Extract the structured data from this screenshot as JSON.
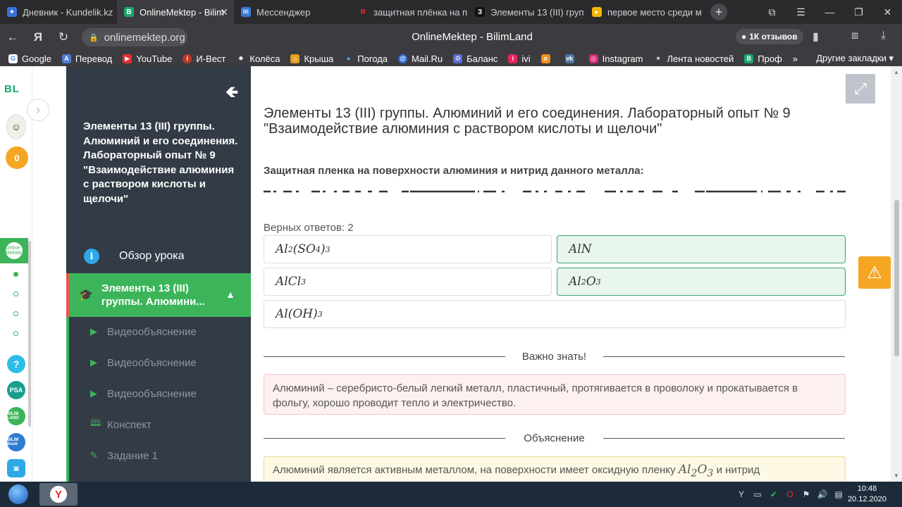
{
  "browser": {
    "tabs": [
      {
        "label": "Дневник - Kundelik.kz",
        "fav": "kundelik-icon",
        "color": "#3a6fd8"
      },
      {
        "label": "OnlineMektep - Bilim",
        "fav": "bilimland-icon",
        "color": "#1aa86b"
      },
      {
        "label": "Мессенджер",
        "fav": "messenger-icon",
        "color": "#3a7bd5"
      },
      {
        "label": "защитная плёнка на п",
        "fav": "yandex-icon",
        "color": "#e62e2e"
      },
      {
        "label": "Элементы 13 (III) груп",
        "fav": "znanija-icon",
        "color": "#111111"
      },
      {
        "label": "первое место среди м",
        "fav": "flag-icon",
        "color": "#f2b705"
      }
    ],
    "new_tab": "+",
    "url": "onlinemektep.org",
    "page_title": "OnlineMektep - BilimLand",
    "reviews": "1К отзывов",
    "bookmarks": [
      "Google",
      "Перевод",
      "YouTube",
      "И-Вест",
      "Колёса",
      "Крыша",
      "Погода",
      "Mail.Ru",
      "Баланс",
      "ivi",
      "",
      "",
      "Instagram",
      "Лента новостей",
      "Проф"
    ],
    "bookmarks_more": "Другие закладки"
  },
  "rail": {
    "logo": "BL",
    "score": "0",
    "help": "?",
    "psa": "PSA",
    "bilimland": "BILIM LAND",
    "bilimbook": "BILIM Book",
    "active_label": "Online Mektep"
  },
  "sidebar": {
    "title": "Элементы 13 (III) группы. Алюминий и его соединения. Лабораторный опыт № 9 \"Взаимодействие алюминия с раствором кислоты и щелочи\"",
    "overview": "Обзор урока",
    "chapter": "Элементы 13 (III) группы. Алюмини...",
    "items": [
      "Видеообъяснение",
      "Видеообъяснение",
      "Видеообъяснение",
      "Конспект",
      "Задание 1"
    ]
  },
  "main": {
    "title": "Элементы 13 (III) группы. Алюминий и его соединения. Лабораторный опыт № 9 \"Взаимодействие алюминия с раствором кислоты и щелочи\"",
    "question": "Защитная пленка на поверхности алюминия и нитрид данного металла:",
    "correct_count": "Верных ответов: 2",
    "options": [
      {
        "id": "al2so43",
        "selected": false
      },
      {
        "id": "aln",
        "selected": true
      },
      {
        "id": "alcl3",
        "selected": false
      },
      {
        "id": "al2o3",
        "selected": true
      },
      {
        "id": "aloh3",
        "selected": false
      }
    ],
    "important_label": "Важно знать!",
    "important_text": "Алюминий – серебристо-белый легкий металл, пластичный, протягивается в проволоку и прокатывается в фольгу, хорошо проводит тепло и электричество.",
    "explanation_label": "Объяснение",
    "explanation_text_start": "Алюминий является активным металлом, на поверхности имеет оксидную пленку",
    "explanation_text_end": "и нитрид"
  },
  "taskbar": {
    "time": "10:48",
    "date": "20.12.2020"
  }
}
